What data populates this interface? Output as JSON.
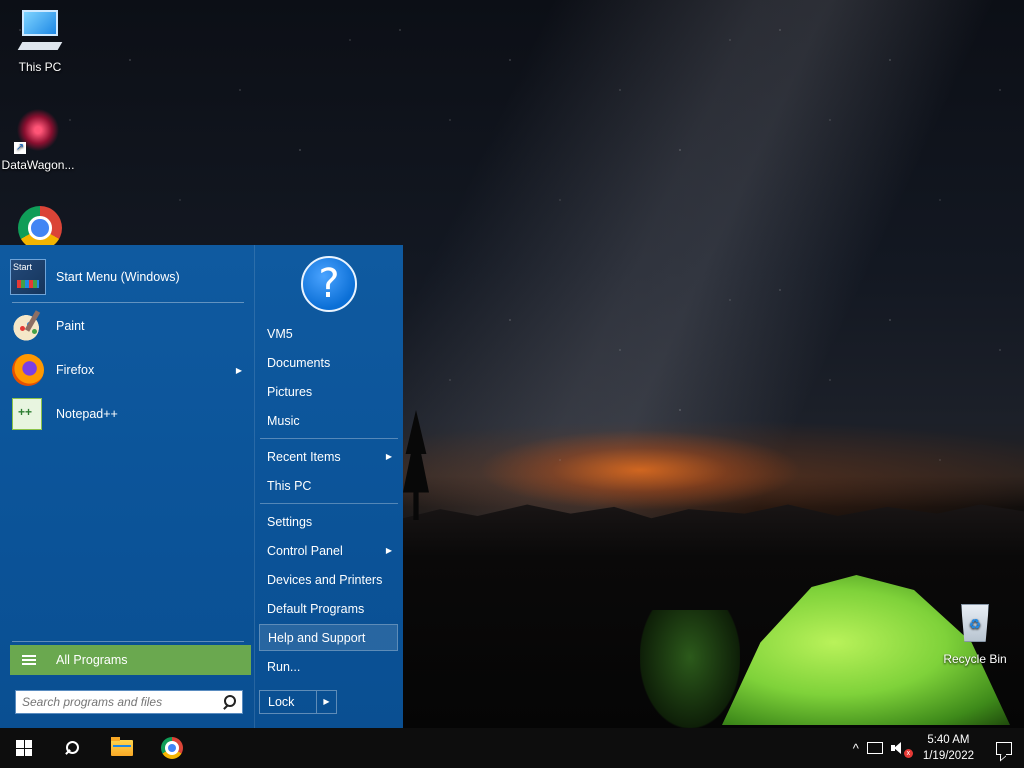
{
  "desktop": {
    "icons": [
      {
        "label": "This PC",
        "icon": "computer-icon"
      },
      {
        "label": "DataWagon...",
        "icon": "datawagon-icon"
      },
      {
        "label": "",
        "icon": "chrome-icon"
      },
      {
        "label": "Recycle Bin",
        "icon": "recycle-bin-icon"
      }
    ]
  },
  "start_menu": {
    "pinned": [
      {
        "label": "Start Menu (Windows)",
        "icon": "start-menu-icon",
        "icon_text": "Start",
        "has_submenu": false
      },
      {
        "label": "Paint",
        "icon": "paint-icon",
        "has_submenu": false
      },
      {
        "label": "Firefox",
        "icon": "firefox-icon",
        "has_submenu": true
      },
      {
        "label": "Notepad++",
        "icon": "notepadpp-icon",
        "has_submenu": false
      }
    ],
    "all_programs_label": "All Programs",
    "search_placeholder": "Search programs and files",
    "right_items": [
      {
        "label": "VM5",
        "has_submenu": false
      },
      {
        "label": "Documents",
        "has_submenu": false
      },
      {
        "label": "Pictures",
        "has_submenu": false
      },
      {
        "label": "Music",
        "has_submenu": false
      },
      {
        "label": "Recent Items",
        "has_submenu": true
      },
      {
        "label": "This PC",
        "has_submenu": false
      },
      {
        "label": "Settings",
        "has_submenu": false
      },
      {
        "label": "Control Panel",
        "has_submenu": true
      },
      {
        "label": "Devices and Printers",
        "has_submenu": false
      },
      {
        "label": "Default Programs",
        "has_submenu": false
      },
      {
        "label": "Help and Support",
        "has_submenu": false,
        "highlighted": true
      },
      {
        "label": "Run...",
        "has_submenu": false
      }
    ],
    "help_glyph": "?",
    "lock_label": "Lock",
    "arrow_glyph": "▶",
    "accent_color": "#6aa84f",
    "menu_color": "#0b5398"
  },
  "taskbar": {
    "pinned": [
      "start-button",
      "search-icon",
      "file-explorer-icon",
      "chrome-icon"
    ],
    "tray": {
      "chevron": "^",
      "time": "5:40 AM",
      "date": "1/19/2022"
    }
  }
}
